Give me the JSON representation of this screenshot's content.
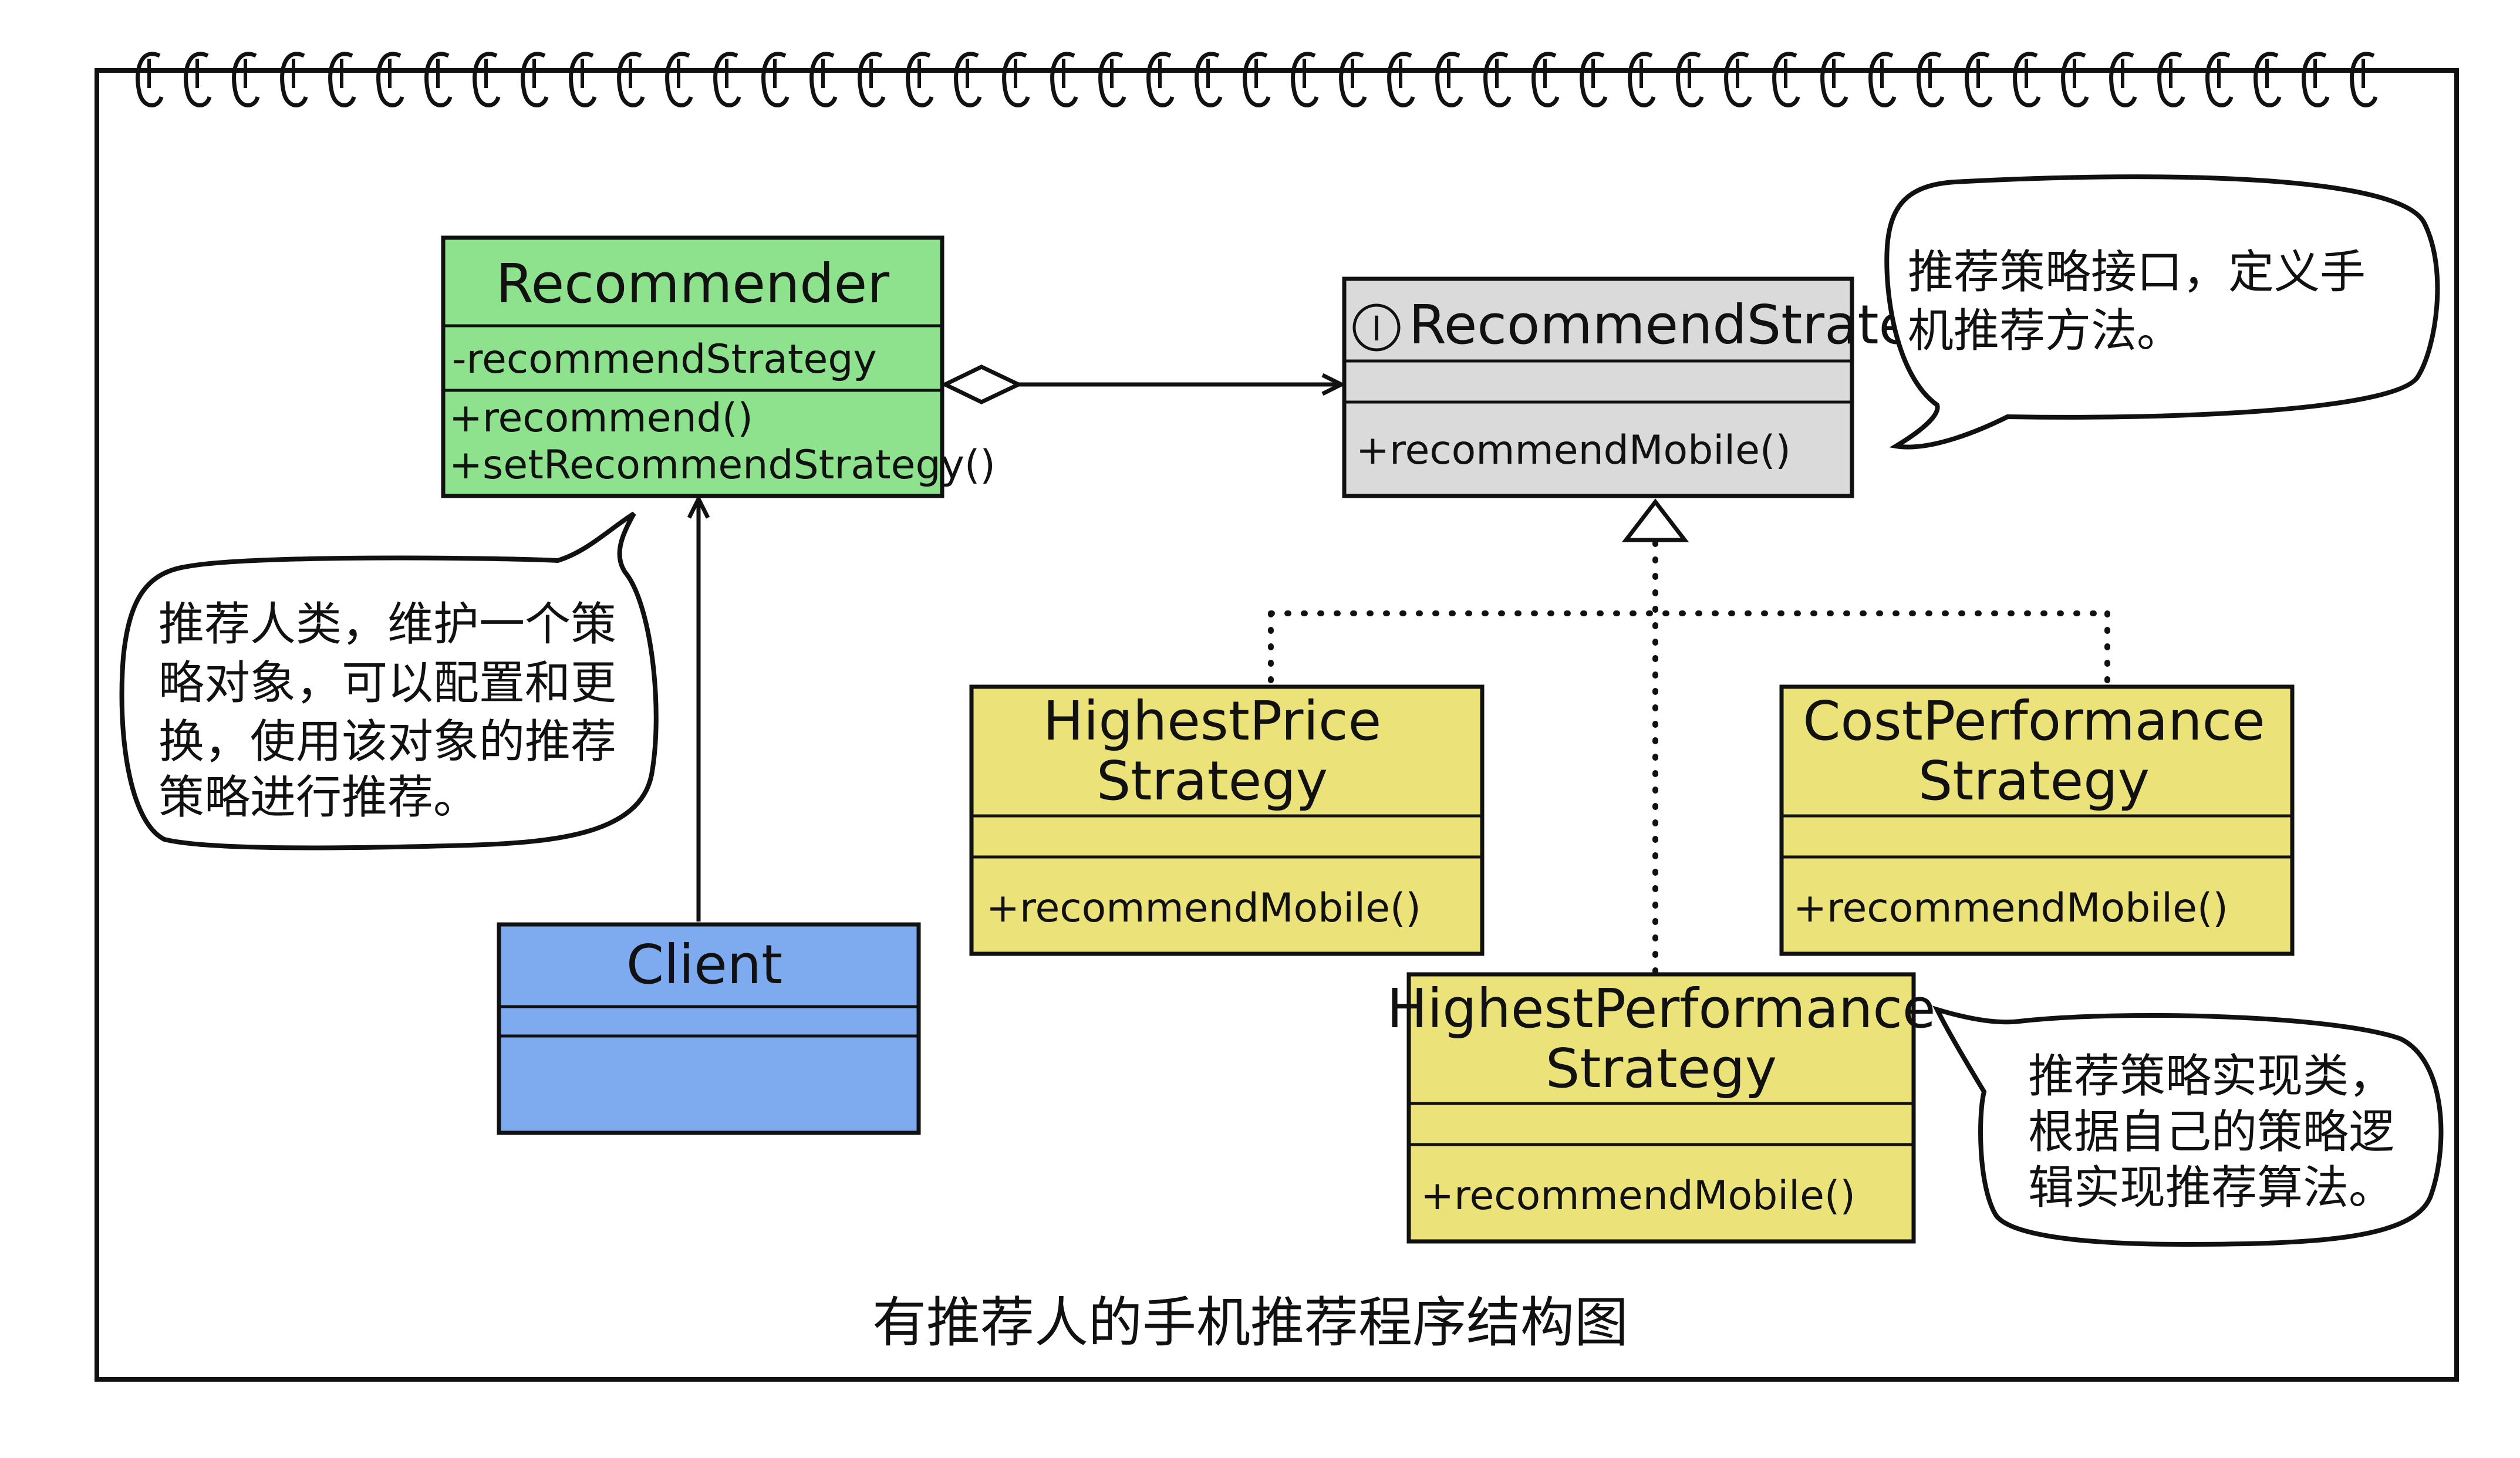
{
  "caption": "有推荐人的手机推荐程序结构图",
  "classes": {
    "recommender": {
      "name": "Recommender",
      "attributes": [
        "-recommendStrategy"
      ],
      "methods": [
        "+recommend()",
        "+setRecommendStrategy()"
      ],
      "color": "#8ee28e"
    },
    "recommend_strategy": {
      "name": "RecommendStrategy",
      "stereotype_icon": "I",
      "methods": [
        "+recommendMobile()"
      ],
      "color": "#dadada"
    },
    "client": {
      "name": "Client",
      "color": "#7eaaf0"
    },
    "highest_price": {
      "name_line1": "HighestPrice",
      "name_line2": "Strategy",
      "methods": [
        "+recommendMobile()"
      ],
      "color": "#ebe37a"
    },
    "cost_performance": {
      "name_line1": "CostPerformance",
      "name_line2": "Strategy",
      "methods": [
        "+recommendMobile()"
      ],
      "color": "#ebe37a"
    },
    "highest_performance": {
      "name_line1": "HighestPerformance",
      "name_line2": "Strategy",
      "methods": [
        "+recommendMobile()"
      ],
      "color": "#ebe37a"
    }
  },
  "notes": {
    "interface_note": [
      "推荐策略接口，定义手",
      "机推荐方法。"
    ],
    "recommender_note": [
      "推荐人类，维护一个策",
      "略对象，可以配置和更",
      "换，使用该对象的推荐",
      "策略进行推荐。"
    ],
    "impl_note": [
      "推荐策略实现类，",
      "根据自己的策略逻",
      "辑实现推荐算法。"
    ]
  }
}
